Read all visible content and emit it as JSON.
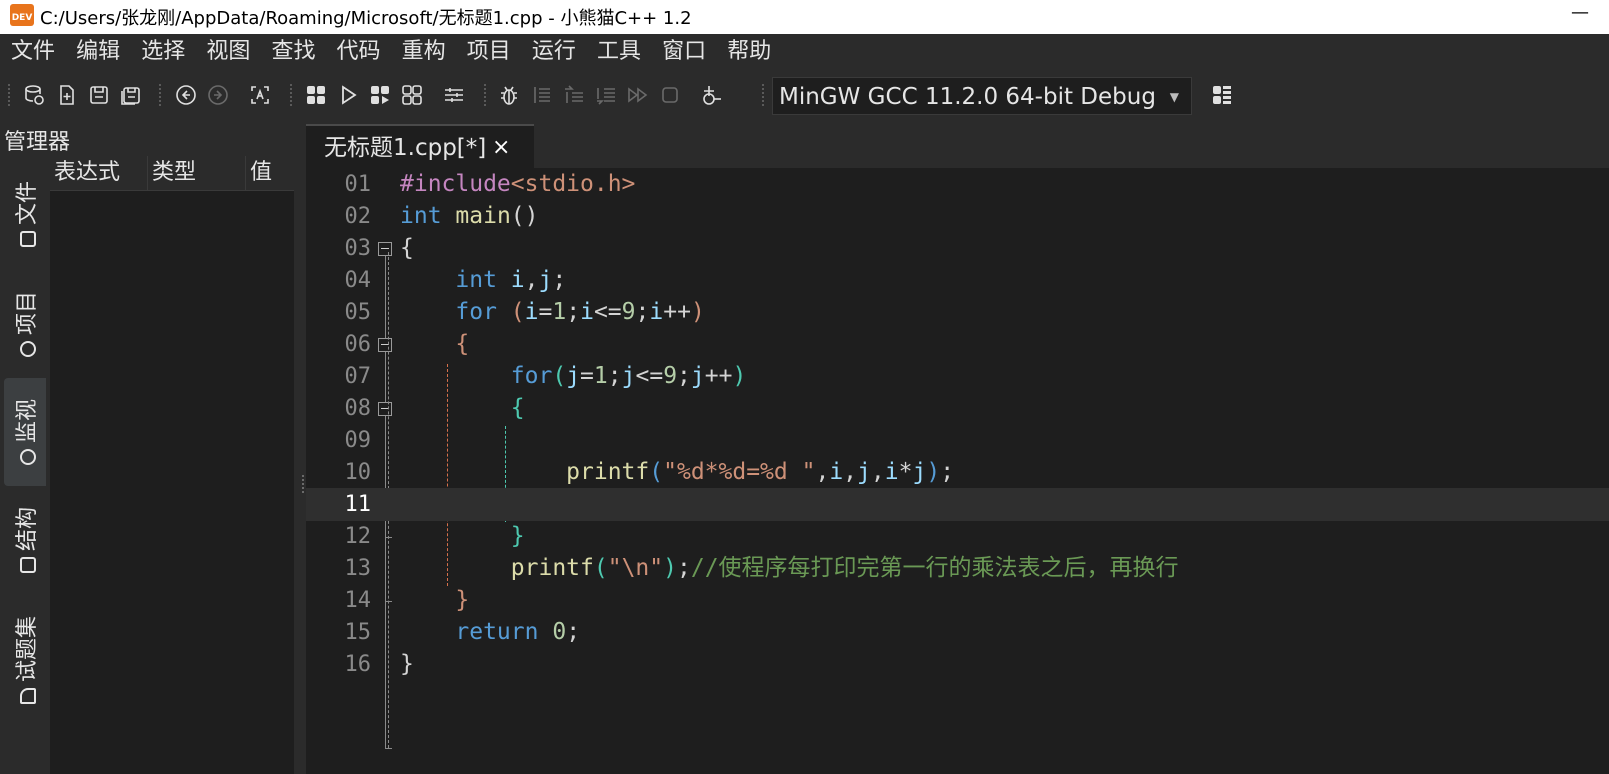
{
  "window": {
    "title": "C:/Users/张龙刚/AppData/Roaming/Microsoft/无标题1.cpp  - 小熊猫C++ 1.2",
    "icon_label": "DEV",
    "minimize": "—"
  },
  "menu": [
    "文件",
    "编辑",
    "选择",
    "视图",
    "查找",
    "代码",
    "重构",
    "项目",
    "运行",
    "工具",
    "窗口",
    "帮助"
  ],
  "toolbar": {
    "compiler": "MinGW GCC 11.2.0 64-bit Debug",
    "icons": [
      "open-project-icon",
      "new-file-icon",
      "save-icon",
      "save-all-icon",
      "back-icon",
      "forward-icon",
      "find-icon",
      "compile-icon",
      "run-icon",
      "compile-run-icon",
      "rebuild-icon",
      "options-icon",
      "debug-icon",
      "step-over-icon",
      "step-into-icon",
      "step-out-icon",
      "continue-icon",
      "stop-icon",
      "add-watch-icon",
      "compiler-options-icon"
    ]
  },
  "left_panel": {
    "title": "管理器",
    "tabs": [
      {
        "label": "文件",
        "icon": "file-icon",
        "active": false
      },
      {
        "label": "项目",
        "icon": "project-icon",
        "active": false
      },
      {
        "label": "监视",
        "icon": "watch-icon",
        "active": true
      },
      {
        "label": "结构",
        "icon": "structure-icon",
        "active": false
      },
      {
        "label": "试题集",
        "icon": "problem-set-icon",
        "active": false
      }
    ],
    "watch_columns": [
      "表达式",
      "类型",
      "值"
    ]
  },
  "editor": {
    "tab_label": "无标题1.cpp[*]",
    "tab_close": "×",
    "current_line": 11,
    "lines": [
      {
        "no": "01",
        "text": "#include<stdio.h>"
      },
      {
        "no": "02",
        "text": "int main()"
      },
      {
        "no": "03",
        "text": "{"
      },
      {
        "no": "04",
        "text": "    int i,j;"
      },
      {
        "no": "05",
        "text": "    for (i=1;i<=9;i++)"
      },
      {
        "no": "06",
        "text": "    {"
      },
      {
        "no": "07",
        "text": "        for(j=1;j<=9;j++)"
      },
      {
        "no": "08",
        "text": "        {"
      },
      {
        "no": "09",
        "text": ""
      },
      {
        "no": "10",
        "text": "            printf(\"%d*%d=%d \",i,j,i*j);"
      },
      {
        "no": "11",
        "text": ""
      },
      {
        "no": "12",
        "text": "        }"
      },
      {
        "no": "13",
        "text": "        printf(\"\\n\");//使程序每打印完第一行的乘法表之后，再换行"
      },
      {
        "no": "14",
        "text": "    }"
      },
      {
        "no": "15",
        "text": "    return 0;"
      },
      {
        "no": "16",
        "text": "}"
      }
    ]
  }
}
